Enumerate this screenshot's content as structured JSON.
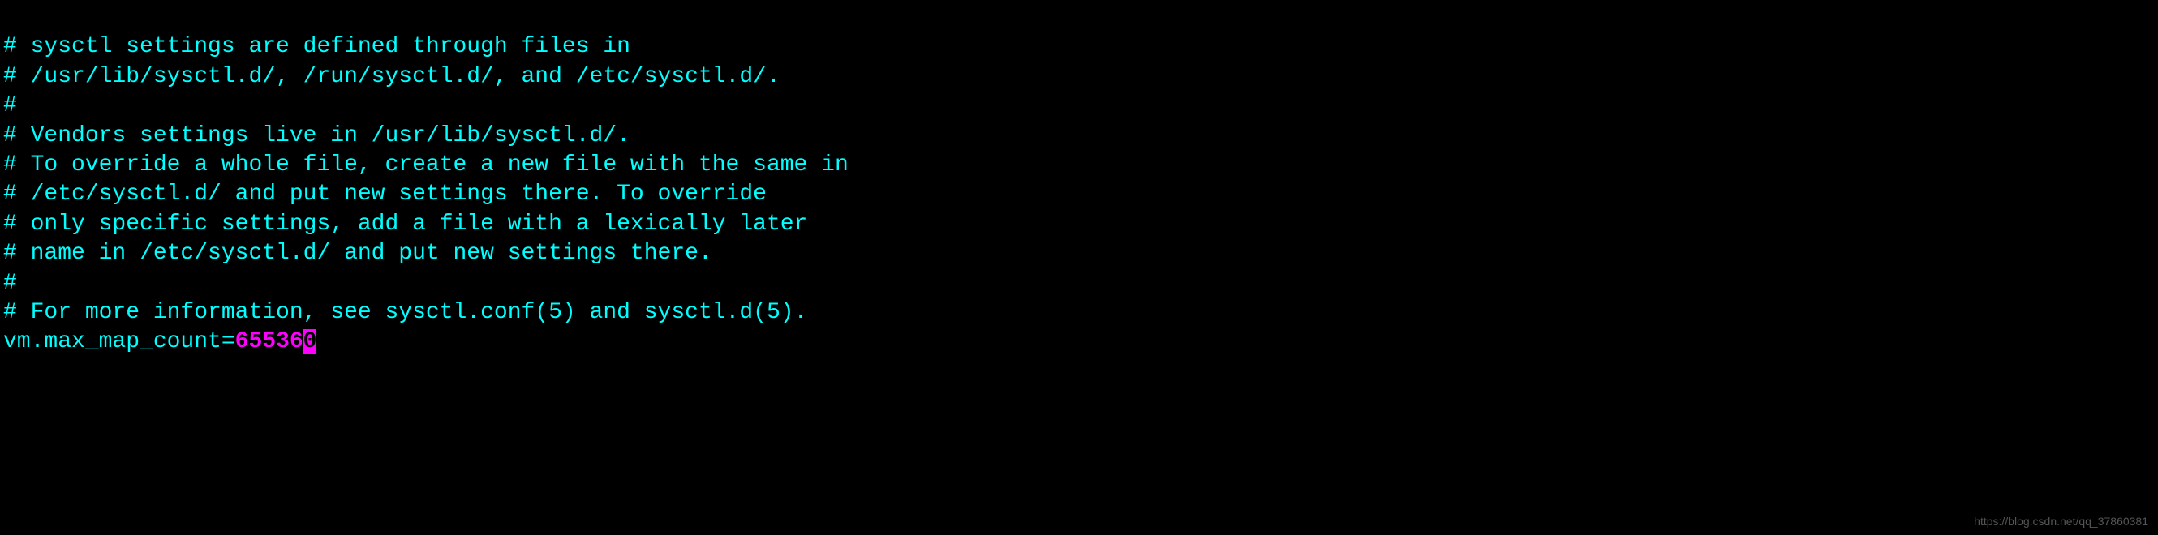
{
  "terminal": {
    "lines": [
      "# sysctl settings are defined through files in",
      "# /usr/lib/sysctl.d/, /run/sysctl.d/, and /etc/sysctl.d/.",
      "#",
      "# Vendors settings live in /usr/lib/sysctl.d/.",
      "# To override a whole file, create a new file with the same in",
      "# /etc/sysctl.d/ and put new settings there. To override",
      "# only specific settings, add a file with a lexically later",
      "# name in /etc/sysctl.d/ and put new settings there.",
      "#",
      "# For more information, see sysctl.conf(5) and sysctl.d(5)."
    ],
    "setting": {
      "key": "vm.max_map_count=",
      "value_prefix": "65536",
      "value_cursor": "0"
    }
  },
  "watermark": "https://blog.csdn.net/qq_37860381"
}
